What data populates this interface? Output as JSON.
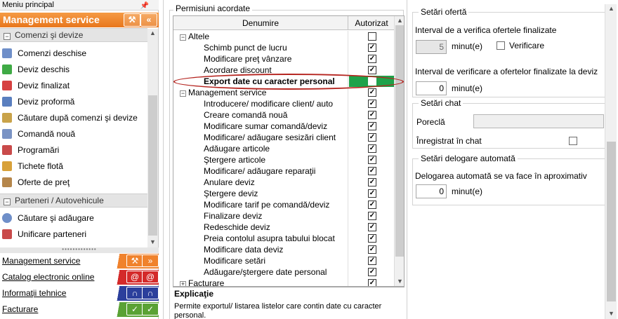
{
  "left_panel": {
    "title": "Meniu principal",
    "header": "Management service",
    "groups": {
      "comenzi": "Comenzi şi devize",
      "parteneri": "Parteneri / Autovehicule"
    },
    "items": [
      {
        "label": "Comenzi deschise"
      },
      {
        "label": "Deviz deschis"
      },
      {
        "label": "Deviz finalizat"
      },
      {
        "label": "Deviz proformă"
      },
      {
        "label": "Căutare după comenzi şi devize"
      },
      {
        "label": "Comandă nouă"
      },
      {
        "label": "Programări"
      },
      {
        "label": "Tichete flotă"
      },
      {
        "label": "Oferte de preţ"
      }
    ],
    "partner_items": [
      {
        "label": "Căutare şi adăugare"
      },
      {
        "label": "Unificare parteneri"
      }
    ],
    "modules": [
      {
        "label": "Management service",
        "color": "#f0822c"
      },
      {
        "label": "Catalog electronic online",
        "color": "#d42a2a"
      },
      {
        "label": "Informaţii tehnice",
        "color": "#2c3f9c"
      },
      {
        "label": "Facturare",
        "color": "#5aa235"
      }
    ]
  },
  "permissions": {
    "title": "Permisiuni acordate",
    "columns": {
      "name": "Denumire",
      "authorized": "Autorizat"
    },
    "rows": [
      {
        "type": "group",
        "label": "Altele",
        "toggle": "−",
        "checked": false
      },
      {
        "type": "item",
        "label": "Schimb punct de lucru",
        "checked": true
      },
      {
        "type": "item",
        "label": "Modificare preţ vânzare",
        "checked": true
      },
      {
        "type": "item",
        "label": "Acordare discount",
        "checked": true
      },
      {
        "type": "item",
        "label": "Export date cu caracter personal",
        "checked": false,
        "selected": true
      },
      {
        "type": "group",
        "label": "Management service",
        "toggle": "−",
        "checked": true
      },
      {
        "type": "item",
        "label": "Introducere/ modificare client/ auto",
        "checked": true
      },
      {
        "type": "item",
        "label": "Creare comandă nouă",
        "checked": true
      },
      {
        "type": "item",
        "label": "Modificare sumar comandă/deviz",
        "checked": true
      },
      {
        "type": "item",
        "label": "Modificare/ adăugare sesizări client",
        "checked": true
      },
      {
        "type": "item",
        "label": "Adăugare articole",
        "checked": true
      },
      {
        "type": "item",
        "label": "Ştergere articole",
        "checked": true
      },
      {
        "type": "item",
        "label": "Modificare/ adăugare reparaţii",
        "checked": true
      },
      {
        "type": "item",
        "label": "Anulare deviz",
        "checked": true
      },
      {
        "type": "item",
        "label": "Ştergere deviz",
        "checked": true
      },
      {
        "type": "item",
        "label": "Modificare tarif pe comandă/deviz",
        "checked": true
      },
      {
        "type": "item",
        "label": "Finalizare deviz",
        "checked": true
      },
      {
        "type": "item",
        "label": "Redeschide deviz",
        "checked": true
      },
      {
        "type": "item",
        "label": "Preia contolul asupra tabului blocat",
        "checked": true
      },
      {
        "type": "item",
        "label": "Modificare data deviz",
        "checked": true
      },
      {
        "type": "item",
        "label": "Modificare setări",
        "checked": true
      },
      {
        "type": "item",
        "label": "Adăugare/ştergere date personal",
        "checked": true
      },
      {
        "type": "group",
        "label": "Facturare",
        "toggle": "+",
        "checked": true
      }
    ],
    "explanation_title": "Explicaţie",
    "explanation_text": "Permite exportul/ listarea listelor care contin date cu caracter personal."
  },
  "settings": {
    "oferta": {
      "title": "Setări ofertă",
      "interval_label": "Interval de a verifica ofertele finalizate",
      "interval_value": "5",
      "interval_unit": "minut(e)",
      "check_label": "Verificare",
      "interval_deviz_label": "Interval de verificare a ofertelor finalizate la deviz",
      "interval_deviz_value": "0",
      "interval_deviz_unit": "minut(e)"
    },
    "chat": {
      "title": "Setări chat",
      "nickname_label": "Poreclă",
      "nickname_value": "",
      "registered_label": "Înregistrat în chat"
    },
    "delegare": {
      "title": "Setări delogare automată",
      "label": "Delogarea automată se va face în aproximativ",
      "value": "0",
      "unit": "minut(e)"
    }
  }
}
